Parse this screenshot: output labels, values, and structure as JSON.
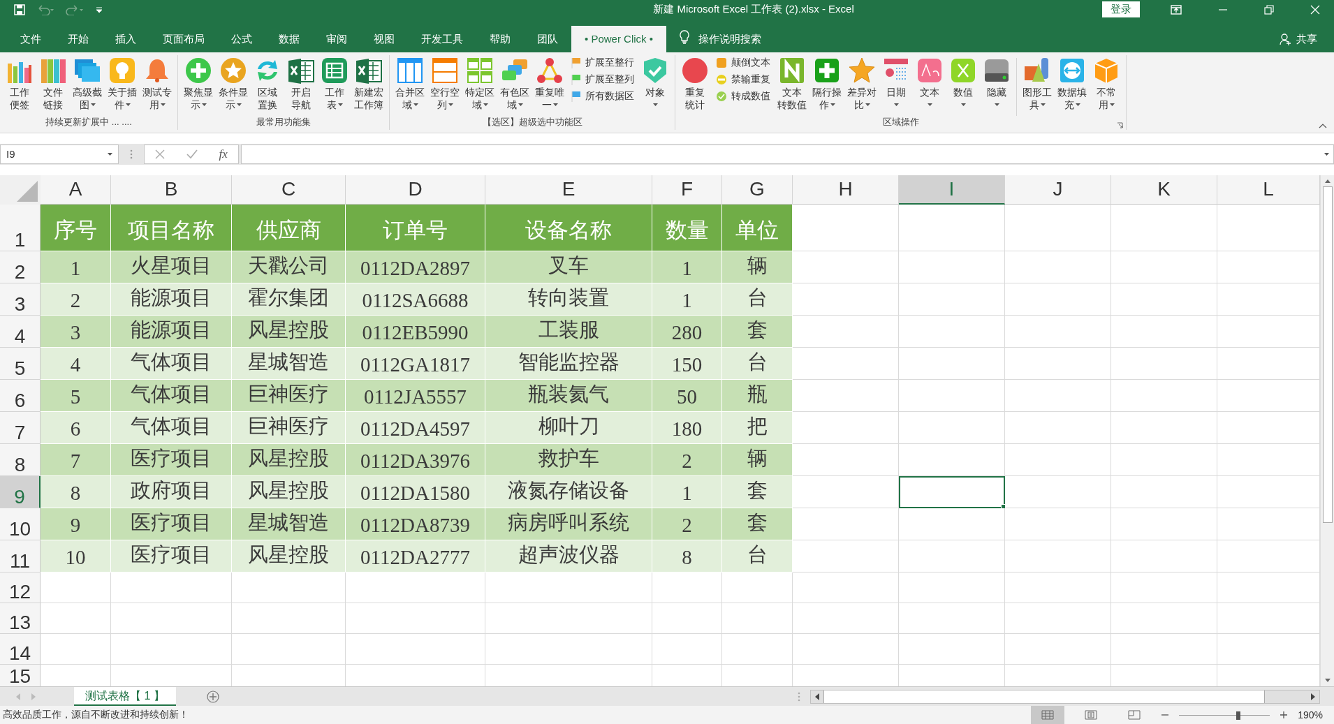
{
  "title_bar": {
    "title": "新建 Microsoft Excel 工作表 (2).xlsx  -  Excel",
    "login": "登录"
  },
  "menu_tabs": [
    {
      "label": "文件",
      "selected": false
    },
    {
      "label": "开始",
      "selected": false
    },
    {
      "label": "插入",
      "selected": false
    },
    {
      "label": "页面布局",
      "selected": false
    },
    {
      "label": "公式",
      "selected": false
    },
    {
      "label": "数据",
      "selected": false
    },
    {
      "label": "审阅",
      "selected": false
    },
    {
      "label": "视图",
      "selected": false
    },
    {
      "label": "开发工具",
      "selected": false
    },
    {
      "label": "帮助",
      "selected": false
    },
    {
      "label": "团队",
      "selected": false
    },
    {
      "label": "• Power Click •",
      "selected": true
    }
  ],
  "tell_me": "操作说明搜索",
  "share": "共享",
  "ribbon": {
    "groups": [
      {
        "label": "持续更新扩展中 ... ....",
        "items": [
          {
            "kind": "large",
            "lines": [
              "工作",
              "便签"
            ],
            "dropdown": false
          },
          {
            "kind": "large",
            "lines": [
              "文件",
              "链接"
            ],
            "dropdown": false
          },
          {
            "kind": "large",
            "lines": [
              "高级截",
              "图"
            ],
            "dropdown": true
          },
          {
            "kind": "large",
            "lines": [
              "关于插",
              "件"
            ],
            "dropdown": true
          },
          {
            "kind": "large",
            "lines": [
              "测试专",
              "用"
            ],
            "dropdown": true
          }
        ]
      },
      {
        "label": "最常用功能集",
        "items": [
          {
            "kind": "large",
            "lines": [
              "聚焦显",
              "示"
            ],
            "dropdown": true
          },
          {
            "kind": "large",
            "lines": [
              "条件显",
              "示"
            ],
            "dropdown": true
          },
          {
            "kind": "large",
            "lines": [
              "区域",
              "置换"
            ],
            "dropdown": false
          },
          {
            "kind": "large",
            "lines": [
              "开启",
              "导航"
            ],
            "dropdown": false
          },
          {
            "kind": "large",
            "lines": [
              "工作",
              "表"
            ],
            "dropdown": true
          },
          {
            "kind": "large",
            "lines": [
              "新建宏",
              "工作簿"
            ],
            "dropdown": false
          }
        ]
      },
      {
        "label": "【选区】超级选中功能区",
        "items": [
          {
            "kind": "large",
            "lines": [
              "合并区",
              "域"
            ],
            "dropdown": true
          },
          {
            "kind": "large",
            "lines": [
              "空行空",
              "列"
            ],
            "dropdown": true
          },
          {
            "kind": "large",
            "lines": [
              "特定区",
              "域"
            ],
            "dropdown": true
          },
          {
            "kind": "large",
            "lines": [
              "有色区",
              "域"
            ],
            "dropdown": true
          },
          {
            "kind": "large",
            "lines": [
              "重复唯",
              "一"
            ],
            "dropdown": true
          },
          {
            "kind": "stack",
            "items": [
              "扩展至整行",
              "扩展至整列",
              "所有数据区"
            ]
          },
          {
            "kind": "large",
            "lines": [
              "对象"
            ],
            "dropdown": true
          }
        ]
      },
      {
        "label": "区域操作",
        "items": [
          {
            "kind": "large",
            "lines": [
              "重复",
              "统计"
            ],
            "dropdown": false
          },
          {
            "kind": "stack",
            "items": [
              "颠倒文本",
              "禁输重复",
              "转成数值"
            ]
          },
          {
            "kind": "large",
            "lines": [
              "文本",
              "转数值"
            ],
            "dropdown": false
          },
          {
            "kind": "large",
            "lines": [
              "隔行操",
              "作"
            ],
            "dropdown": true
          },
          {
            "kind": "large",
            "lines": [
              "差异对",
              "比"
            ],
            "dropdown": true
          },
          {
            "kind": "large",
            "lines": [
              "日期"
            ],
            "dropdown": true
          },
          {
            "kind": "large",
            "lines": [
              "文本"
            ],
            "dropdown": true
          },
          {
            "kind": "large",
            "lines": [
              "数值"
            ],
            "dropdown": true
          },
          {
            "kind": "large",
            "lines": [
              "隐藏"
            ],
            "dropdown": true
          },
          {
            "kind": "separator"
          },
          {
            "kind": "large",
            "lines": [
              "图形工",
              "具"
            ],
            "dropdown": true
          },
          {
            "kind": "large",
            "lines": [
              "数据填",
              "充"
            ],
            "dropdown": true
          },
          {
            "kind": "large",
            "lines": [
              "不常",
              "用"
            ],
            "dropdown": true
          }
        ]
      }
    ]
  },
  "formula_bar": {
    "name_box": "I9",
    "fx": "fx"
  },
  "sheet": {
    "columns": [
      {
        "letter": "A",
        "selected": false
      },
      {
        "letter": "B",
        "selected": false
      },
      {
        "letter": "C",
        "selected": false
      },
      {
        "letter": "D",
        "selected": false
      },
      {
        "letter": "E",
        "selected": false
      },
      {
        "letter": "F",
        "selected": false
      },
      {
        "letter": "G",
        "selected": false
      },
      {
        "letter": "H",
        "selected": false
      },
      {
        "letter": "I",
        "selected": true
      },
      {
        "letter": "J",
        "selected": false
      },
      {
        "letter": "K",
        "selected": false
      },
      {
        "letter": "L",
        "selected": false
      }
    ],
    "rows": [
      {
        "number": "1",
        "selected": false,
        "kind": "header",
        "cells": [
          "序号",
          "项目名称",
          "供应商",
          "订单号",
          "设备名称",
          "数量",
          "单位"
        ]
      },
      {
        "number": "2",
        "selected": false,
        "kind": "data",
        "cells": [
          "1",
          "火星项目",
          "天戳公司",
          "0112DA2897",
          "叉车",
          "1",
          "辆"
        ]
      },
      {
        "number": "3",
        "selected": false,
        "kind": "data",
        "cells": [
          "2",
          "能源项目",
          "霍尔集团",
          "0112SA6688",
          "转向装置",
          "1",
          "台"
        ]
      },
      {
        "number": "4",
        "selected": false,
        "kind": "data",
        "cells": [
          "3",
          "能源项目",
          "风星控股",
          "0112EB5990",
          "工装服",
          "280",
          "套"
        ]
      },
      {
        "number": "5",
        "selected": false,
        "kind": "data",
        "cells": [
          "4",
          "气体项目",
          "星城智造",
          "0112GA1817",
          "智能监控器",
          "150",
          "台"
        ]
      },
      {
        "number": "6",
        "selected": false,
        "kind": "data",
        "cells": [
          "5",
          "气体项目",
          "巨神医疗",
          "0112JA5557",
          "瓶装氦气",
          "50",
          "瓶"
        ]
      },
      {
        "number": "7",
        "selected": false,
        "kind": "data",
        "cells": [
          "6",
          "气体项目",
          "巨神医疗",
          "0112DA4597",
          "柳叶刀",
          "180",
          "把"
        ]
      },
      {
        "number": "8",
        "selected": false,
        "kind": "data",
        "cells": [
          "7",
          "医疗项目",
          "风星控股",
          "0112DA3976",
          "救护车",
          "2",
          "辆"
        ]
      },
      {
        "number": "9",
        "selected": true,
        "kind": "data",
        "cells": [
          "8",
          "政府项目",
          "风星控股",
          "0112DA1580",
          "液氮存储设备",
          "1",
          "套"
        ]
      },
      {
        "number": "10",
        "selected": false,
        "kind": "data",
        "cells": [
          "9",
          "医疗项目",
          "星城智造",
          "0112DA8739",
          "病房呼叫系统",
          "2",
          "套"
        ]
      },
      {
        "number": "11",
        "selected": false,
        "kind": "data",
        "cells": [
          "10",
          "医疗项目",
          "风星控股",
          "0112DA2777",
          "超声波仪器",
          "8",
          "台"
        ]
      },
      {
        "number": "12",
        "selected": false,
        "kind": "blank"
      },
      {
        "number": "13",
        "selected": false,
        "kind": "blank"
      },
      {
        "number": "14",
        "selected": false,
        "kind": "blank"
      },
      {
        "number": "15",
        "selected": false,
        "kind": "blank"
      }
    ]
  },
  "sheet_tabs": [
    {
      "label": "测试表格【 1 】",
      "selected": true
    }
  ],
  "status_bar": {
    "message": "高效品质工作，源自不断改进和持续创新！",
    "zoom": {
      "level": 0.65,
      "reading": "190%"
    }
  }
}
